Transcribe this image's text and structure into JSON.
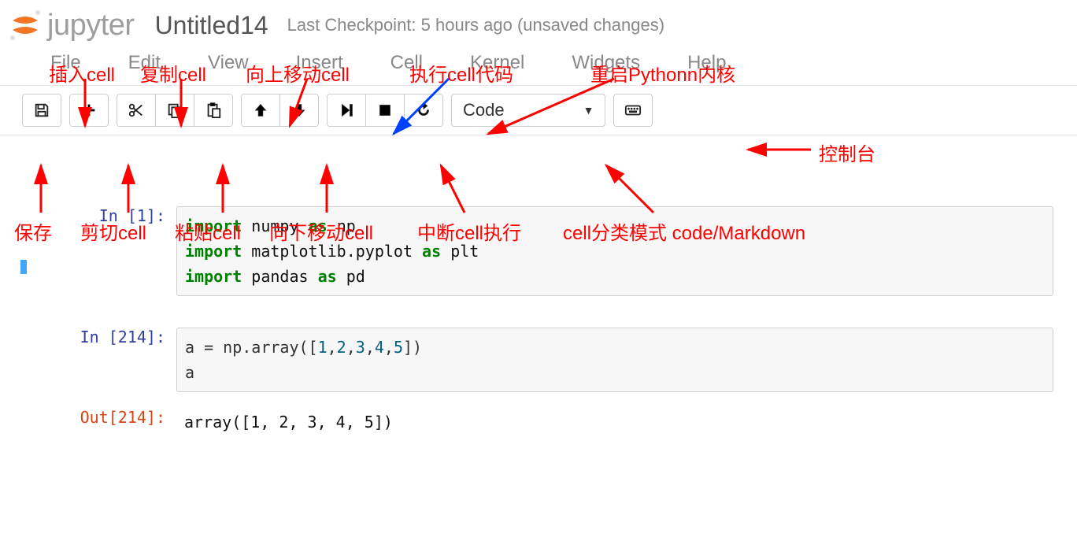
{
  "header": {
    "logo_text": "jupyter",
    "title": "Untitled14",
    "checkpoint": "Last Checkpoint: 5 hours ago (unsaved changes)"
  },
  "menu": {
    "file": "File",
    "edit": "Edit",
    "view": "View",
    "insert": "Insert",
    "cell": "Cell",
    "kernel": "Kernel",
    "widgets": "Widgets",
    "help": "Help"
  },
  "toolbar": {
    "celltype_label": "Code"
  },
  "annotations": {
    "insert_cell": "插入cell",
    "copy_cell": "复制cell",
    "move_up": "向上移动cell",
    "run_cell": "执行cell代码",
    "restart_kernel": "重启Pythonn内核",
    "save": "保存",
    "cut_cell": "剪切cell",
    "paste_cell": "粘贴cell",
    "move_down": "向下移动cell",
    "interrupt": "中断cell执行",
    "celltype_mode": "cell分类模式 code/Markdown",
    "console": "控制台"
  },
  "cells": [
    {
      "in_prompt": "In  [1]:",
      "code_html": "<span class='kw'>import</span> <span class='mod'>numpy</span> <span class='kw'>as</span> <span class='mod'>np</span>\n<span class='kw'>import</span> <span class='mod'>matplotlib.pyplot</span> <span class='kw'>as</span> <span class='mod'>plt</span>\n<span class='kw'>import</span> <span class='mod'>pandas</span> <span class='kw'>as</span> <span class='mod'>pd</span>"
    },
    {
      "in_prompt": "In [214]:",
      "code_html": "a = np.array([<span class='num'>1</span>,<span class='num'>2</span>,<span class='num'>3</span>,<span class='num'>4</span>,<span class='num'>5</span>])\na",
      "out_prompt": "Out[214]:",
      "out_text": "array([1, 2, 3, 4, 5])"
    }
  ]
}
